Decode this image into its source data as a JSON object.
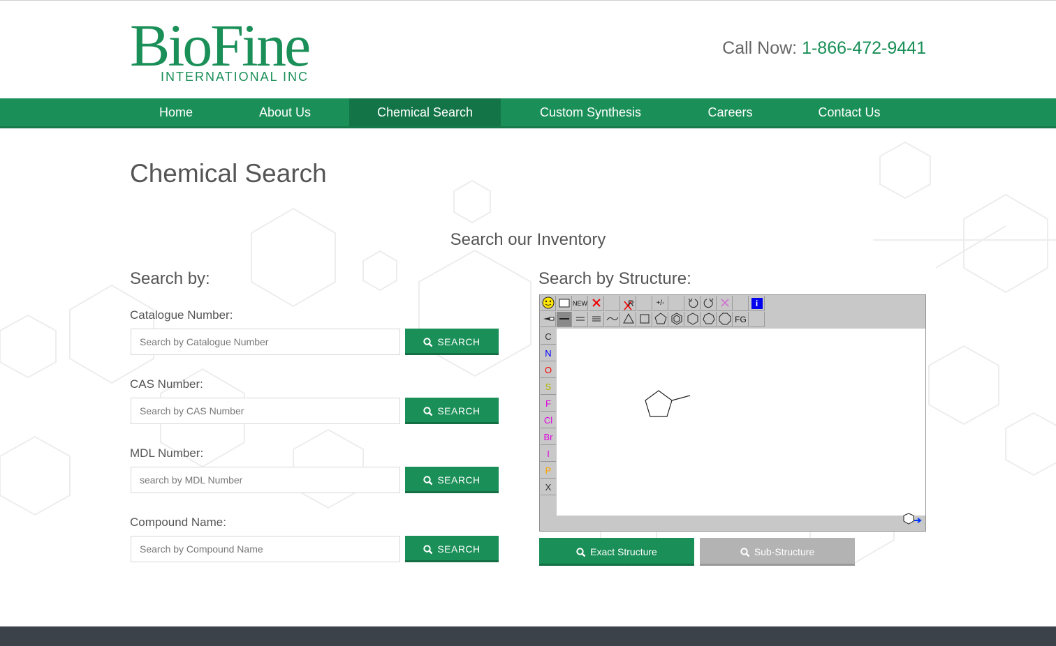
{
  "header": {
    "logo_main": "BioFine",
    "logo_sub": "INTERNATIONAL INC",
    "call_label": "Call Now: ",
    "call_number": "1-866-472-9441"
  },
  "nav": {
    "items": [
      {
        "label": "Home"
      },
      {
        "label": "About Us"
      },
      {
        "label": "Chemical Search",
        "active": true
      },
      {
        "label": "Custom Synthesis"
      },
      {
        "label": "Careers"
      },
      {
        "label": "Contact Us"
      }
    ]
  },
  "page": {
    "title": "Chemical Search",
    "subtitle": "Search our Inventory"
  },
  "search_by": {
    "heading": "Search by:",
    "button_label": "SEARCH",
    "fields": [
      {
        "label": "Catalogue Number:",
        "placeholder": "Search by Catalogue Number",
        "value": ""
      },
      {
        "label": "CAS Number:",
        "placeholder": "Search by CAS Number",
        "value": ""
      },
      {
        "label": "MDL Number:",
        "placeholder": "search by MDL Number",
        "value": ""
      },
      {
        "label": "Compound Name:",
        "placeholder": "Search by Compound Name",
        "value": ""
      }
    ]
  },
  "structure": {
    "heading": "Search by Structure:",
    "toolbar_new": "NEW",
    "toolbar_fg": "FG",
    "toolbar_r": "R",
    "toolbar_charge": "+/-",
    "toolbar_info": "i",
    "atoms": [
      {
        "symbol": "C",
        "color": "#333333"
      },
      {
        "symbol": "N",
        "color": "#0000ff"
      },
      {
        "symbol": "O",
        "color": "#ff0000"
      },
      {
        "symbol": "S",
        "color": "#b5b500"
      },
      {
        "symbol": "F",
        "color": "#e000e0"
      },
      {
        "symbol": "Cl",
        "color": "#e000e0"
      },
      {
        "symbol": "Br",
        "color": "#e000e0"
      },
      {
        "symbol": "I",
        "color": "#e000e0"
      },
      {
        "symbol": "P",
        "color": "#ffa500"
      },
      {
        "symbol": "X",
        "color": "#333333"
      }
    ],
    "exact_label": "Exact Structure",
    "sub_label": "Sub-Structure"
  },
  "colors": {
    "brand_green": "#1a8f58",
    "nav_active": "#137547",
    "footer": "#3b4249"
  }
}
